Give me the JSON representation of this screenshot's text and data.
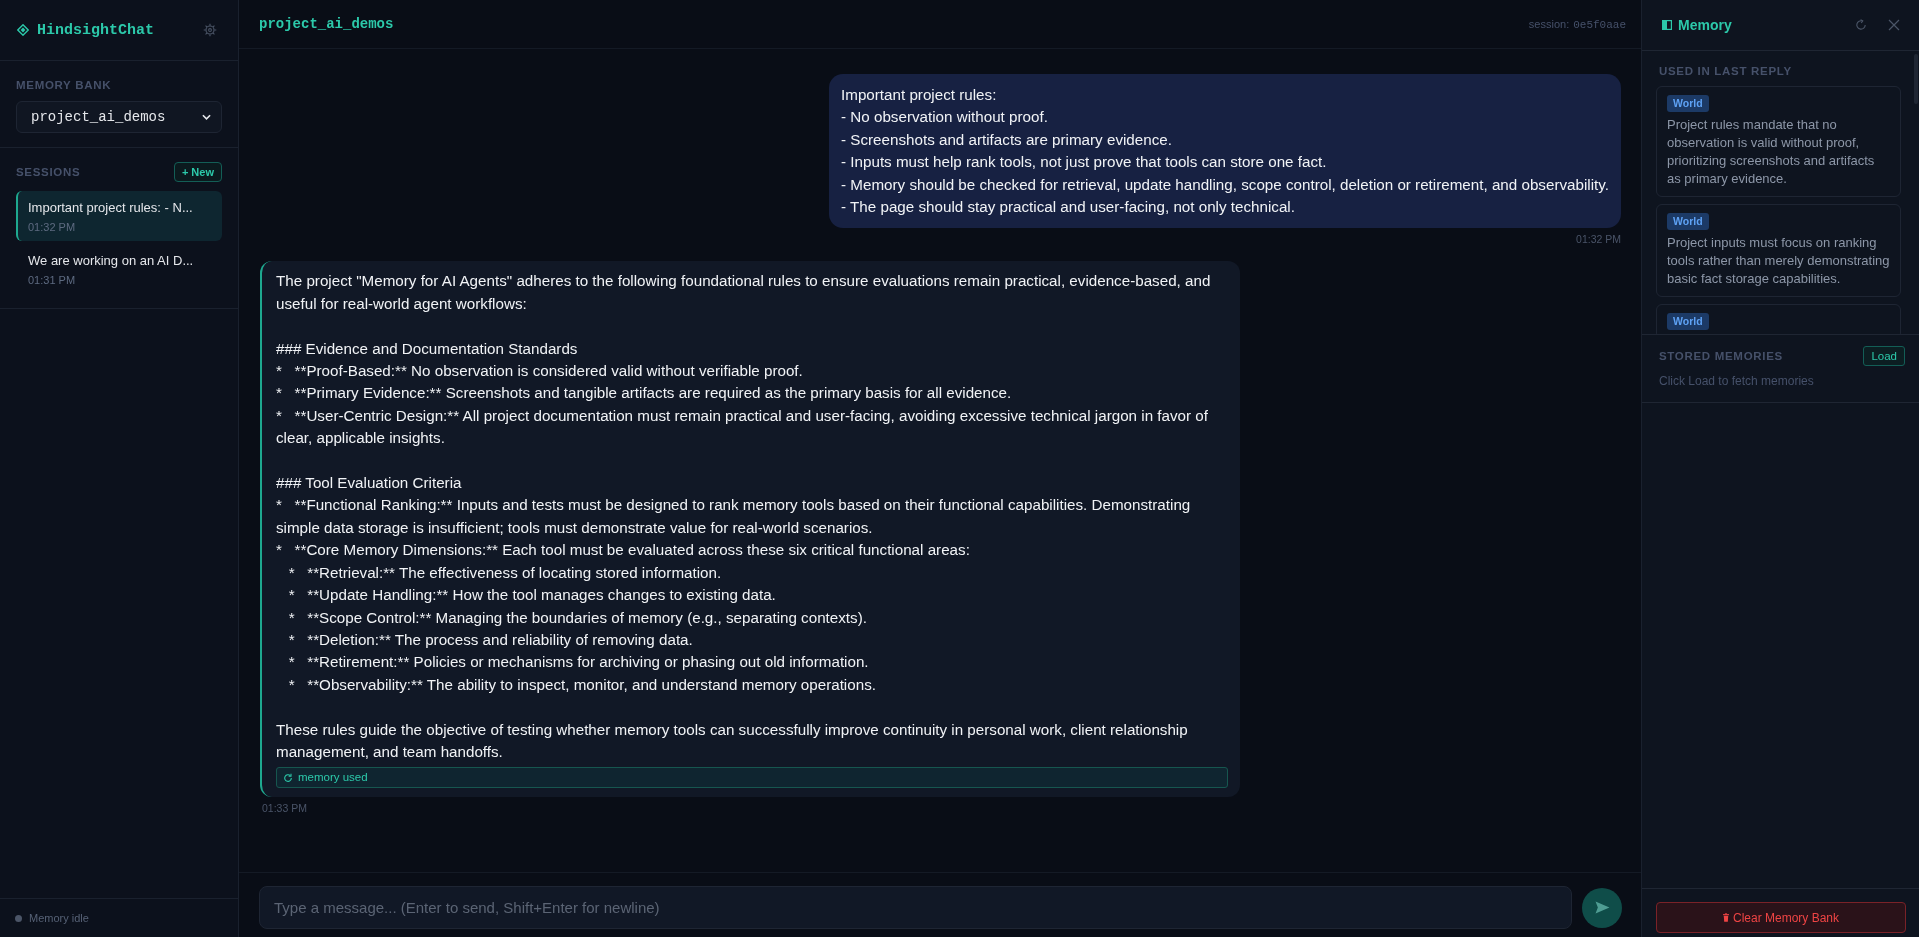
{
  "sidebar": {
    "app_name": "HindsightChat",
    "memory_bank": {
      "label": "MEMORY BANK",
      "value": "project_ai_demos"
    },
    "sessions": {
      "label": "SESSIONS",
      "new_button": "+ New",
      "items": [
        {
          "title": "Important project rules: - N...",
          "time": "01:32 PM",
          "selected": true
        },
        {
          "title": "We are working on an AI D...",
          "time": "01:31 PM",
          "selected": false
        }
      ]
    },
    "status": {
      "label": "Memory idle",
      "active": false
    }
  },
  "chat": {
    "title": "project_ai_demos",
    "session_label": "session:",
    "session_id": "0e5f0aae",
    "messages": [
      {
        "kind": "user",
        "blocks": [
          [
            "Important project rules:",
            "- No observation without proof.",
            "- Screenshots and artifacts are primary evidence.",
            "- Inputs must help rank tools, not just prove that tools can store one fact.",
            "- Memory should be checked for retrieval, update handling, scope control, deletion or retirement, and observability.",
            "- The page should stay practical and user-facing, not only technical."
          ]
        ],
        "time": "01:32 PM"
      },
      {
        "kind": "assistant",
        "blocks": [
          [
            "The project \"Memory for AI Agents\" adheres to the following foundational rules to ensure evaluations remain practical, evidence-based, and useful for real-world agent workflows:"
          ],
          [
            "### Evidence and Documentation Standards",
            "*   **Proof-Based:** No observation is considered valid without verifiable proof.",
            "*   **Primary Evidence:** Screenshots and tangible artifacts are required as the primary basis for all evidence.",
            "*   **User-Centric Design:** All project documentation must remain practical and user-facing, avoiding excessive technical jargon in favor of clear, applicable insights."
          ],
          [
            "### Tool Evaluation Criteria",
            "*   **Functional Ranking:** Inputs and tests must be designed to rank memory tools based on their functional capabilities. Demonstrating simple data storage is insufficient; tools must demonstrate value for real-world scenarios.",
            "*   **Core Memory Dimensions:** Each tool must be evaluated across these six critical functional areas:",
            "   *   **Retrieval:** The effectiveness of locating stored information.",
            "   *   **Update Handling:** How the tool manages changes to existing data.",
            "   *   **Scope Control:** Managing the boundaries of memory (e.g., separating contexts).",
            "   *   **Deletion:** The process and reliability of removing data.",
            "   *   **Retirement:** Policies or mechanisms for archiving or phasing out old information.",
            "   *   **Observability:** The ability to inspect, monitor, and understand memory operations."
          ],
          [
            "These rules guide the objective of testing whether memory tools can successfully improve continuity in personal work, client relationship management, and team handoffs."
          ]
        ],
        "memory_used": "memory used",
        "time": "01:33 PM"
      }
    ],
    "composer": {
      "placeholder": "Type a message... (Enter to send, Shift+Enter for newline)"
    }
  },
  "memory_panel": {
    "title": "Memory",
    "used": {
      "label": "USED IN LAST REPLY",
      "items": [
        {
          "tag": "World",
          "text": "Project rules mandate that no observation is valid without proof, prioritizing screenshots and artifacts as primary evidence."
        },
        {
          "tag": "World",
          "text": "Project inputs must focus on ranking tools rather than merely demonstrating basic fact storage capabilities."
        },
        {
          "tag": "World"
        }
      ]
    },
    "stored": {
      "label": "STORED MEMORIES",
      "load_button": "Load",
      "hint": "Click Load to fetch memories"
    },
    "clear_button": "Clear Memory Bank"
  }
}
